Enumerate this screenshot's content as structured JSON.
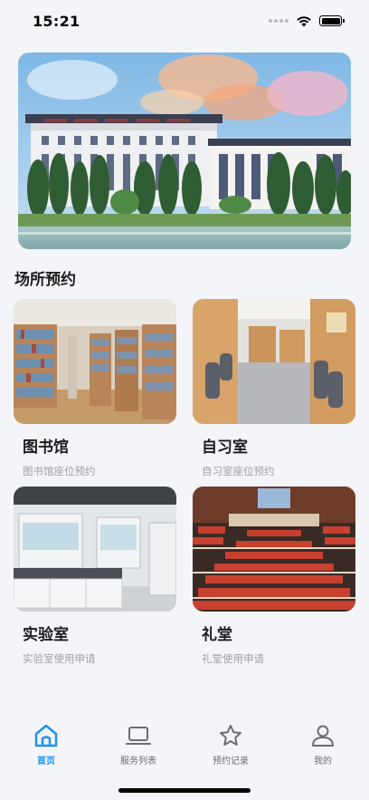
{
  "status": {
    "time": "15:21"
  },
  "colors": {
    "accent": "#1f8ff0",
    "inactive": "#6b6d72",
    "subtitle": "#9ea0a6"
  },
  "section": {
    "title": "场所预约"
  },
  "venues": [
    {
      "title": "图书馆",
      "subtitle": "图书馆座位预约",
      "image": "library-shelves"
    },
    {
      "title": "自习室",
      "subtitle": "自习室座位预约",
      "image": "study-carrels"
    },
    {
      "title": "实验室",
      "subtitle": "实验室使用申请",
      "image": "laboratory-benches"
    },
    {
      "title": "礼堂",
      "subtitle": "礼堂使用申请",
      "image": "auditorium-seats"
    }
  ],
  "tabs": [
    {
      "label": "首页",
      "icon": "home-icon",
      "active": true
    },
    {
      "label": "服务列表",
      "icon": "laptop-icon",
      "active": false
    },
    {
      "label": "预约记录",
      "icon": "star-icon",
      "active": false
    },
    {
      "label": "我的",
      "icon": "person-icon",
      "active": false
    }
  ]
}
